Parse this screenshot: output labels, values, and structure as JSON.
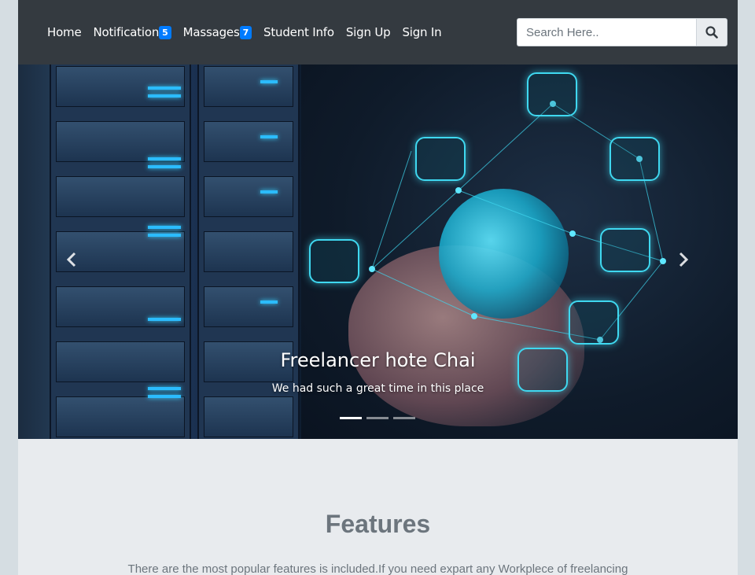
{
  "navbar": {
    "links": [
      {
        "label": "Home"
      },
      {
        "label": "Notification",
        "badge": "5"
      },
      {
        "label": "Massages",
        "badge": "7"
      },
      {
        "label": "Student Info"
      },
      {
        "label": "Sign Up"
      },
      {
        "label": "Sign In"
      }
    ],
    "search": {
      "placeholder": "Search Here..",
      "value": "",
      "button_icon": "search-icon"
    }
  },
  "carousel": {
    "caption_title": "Freelancer hote Chai",
    "caption_subtitle": "We had such a great time in this place",
    "indicators": 3,
    "active_index": 0,
    "prev_icon": "chevron-left-icon",
    "next_icon": "chevron-right-icon"
  },
  "features": {
    "title": "Features",
    "description": "There are the most popular features is included.If you need expart any Workplece of freelancing"
  },
  "colors": {
    "navbar_bg": "#343a40",
    "badge": "#007bff",
    "section_bg": "#e8ebee",
    "muted_text": "#6c757d"
  }
}
